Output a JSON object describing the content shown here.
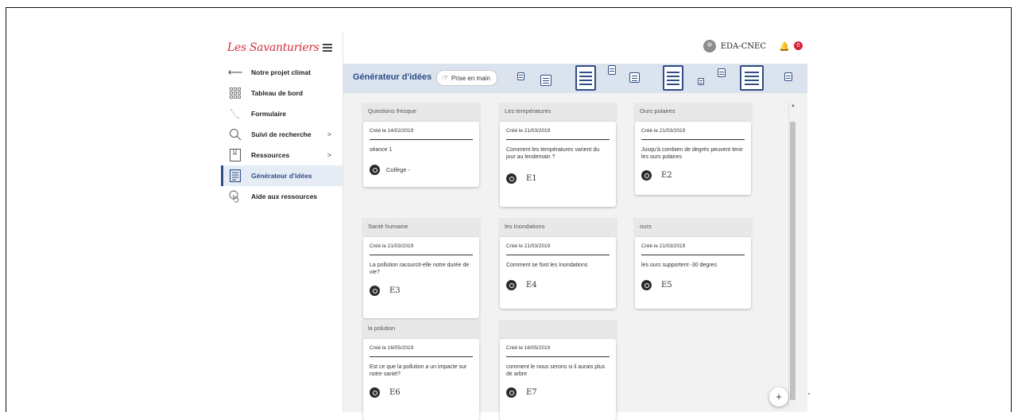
{
  "app": {
    "logo": "Les Savanturiers",
    "user_name": "EDA-CNEC",
    "notification_count": "0"
  },
  "sidebar": {
    "items": [
      {
        "label": "Notre projet climat",
        "icon": "arrow-left-icon"
      },
      {
        "label": "Tableau de bord",
        "icon": "grid-icon"
      },
      {
        "label": "Formulaire",
        "icon": "form-icon"
      },
      {
        "label": "Suivi de recherche",
        "icon": "search-icon",
        "chevron": ">"
      },
      {
        "label": "Ressources",
        "icon": "book-icon",
        "chevron": ">"
      },
      {
        "label": "Générateur d'idées",
        "icon": "document-icon",
        "active": true
      },
      {
        "label": "Aide aux ressources",
        "icon": "hand-icon"
      }
    ]
  },
  "header": {
    "title": "Générateur d'idées",
    "prise_label": "Prise en main"
  },
  "cards": [
    {
      "title": "Questions fresque",
      "date": "Créé le 14/02/2019",
      "text": "séance 1",
      "label": "Collège -"
    },
    {
      "title": "Les températures",
      "date": "Créé le 21/03/2019",
      "text": "Comment les températures varient du jour au lendemain ?",
      "label": "E1"
    },
    {
      "title": "Ours polaires",
      "date": "Créé le 21/03/2019",
      "text": "Jusqu'à combien de degrés peuvent tenir les ours polaires",
      "label": "E2"
    },
    {
      "title": "Santé humaine",
      "date": "Créé le 21/03/2019",
      "text": "La pollution racourcit-elle notre durée de vie?",
      "label": "E3"
    },
    {
      "title": "les Inondations",
      "date": "Créé le 21/03/2019",
      "text": "Comment se font les Inondations",
      "label": "E4"
    },
    {
      "title": "ours",
      "date": "Créé le 21/03/2019",
      "text": "les ours supportent -30 degres",
      "label": "E5"
    },
    {
      "title": "la polution",
      "date": "Créé le 16/05/2019",
      "text": "Est ce que la pollution a un impacte sur notre santé?",
      "label": "E6"
    },
    {
      "title": "",
      "date": "Créé le 16/05/2019",
      "text": "comment le nous serons si il aurais plus de arbre",
      "label": "E7"
    }
  ],
  "fab_label": "+"
}
